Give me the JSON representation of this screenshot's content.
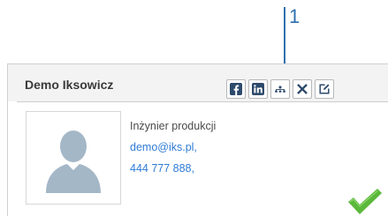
{
  "callout": {
    "number": "1",
    "color": "#2f6fb0"
  },
  "contact": {
    "name": "Demo Iksowicz",
    "job_title": "Inżynier produkcji",
    "email": "demo@iks.pl,",
    "phone": "444 777 888,"
  },
  "toolbar": {
    "buttons": [
      {
        "icon": "facebook-icon"
      },
      {
        "icon": "linkedin-icon"
      },
      {
        "icon": "org-chart-icon"
      },
      {
        "icon": "close-icon"
      },
      {
        "icon": "edit-icon"
      }
    ]
  },
  "photo": {
    "icon": "avatar-placeholder-icon"
  },
  "status": {
    "icon": "checkmark-icon",
    "color": "#5ab83a"
  },
  "colors": {
    "link": "#2e7bd6",
    "header_bg": "#f3f3f3",
    "icon_dark": "#2d4a6b"
  }
}
